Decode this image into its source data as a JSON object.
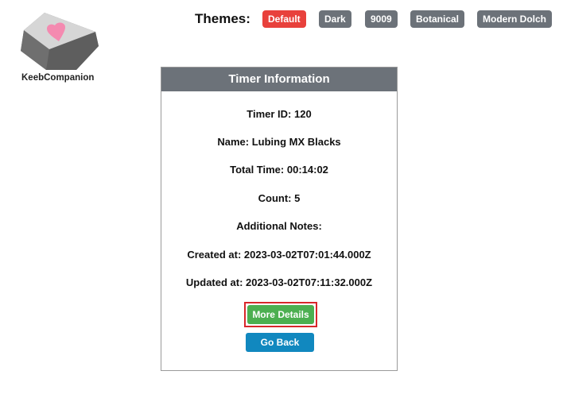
{
  "logo": {
    "text": "KeebCompanion",
    "icon": "keycap-heart-icon",
    "heart_color": "#f48ab0"
  },
  "themes": {
    "label": "Themes:",
    "options": [
      "Default",
      "Dark",
      "9009",
      "Botanical",
      "Modern Dolch"
    ],
    "active": "Default"
  },
  "card": {
    "title": "Timer Information",
    "timer_id": {
      "label": "Timer ID:",
      "value": "120"
    },
    "name": {
      "label": "Name:",
      "value": "Lubing MX Blacks"
    },
    "total_time": {
      "label": "Total Time:",
      "value": "00:14:02"
    },
    "count": {
      "label": "Count:",
      "value": "5"
    },
    "additional_notes": {
      "label": "Additional Notes:",
      "value": ""
    },
    "created_at": {
      "label": "Created at:",
      "value": "2023-03-02T07:01:44.000Z"
    },
    "updated_at": {
      "label": "Updated at:",
      "value": "2023-03-02T07:11:32.000Z"
    },
    "more_details_label": "More Details",
    "go_back_label": "Go Back"
  },
  "colors": {
    "header": "#6c7279",
    "active_theme": "#e8413c",
    "theme_button": "#6c7279",
    "more_details": "#4caf50",
    "go_back": "#1188bf",
    "highlight_border": "#d8262a"
  }
}
